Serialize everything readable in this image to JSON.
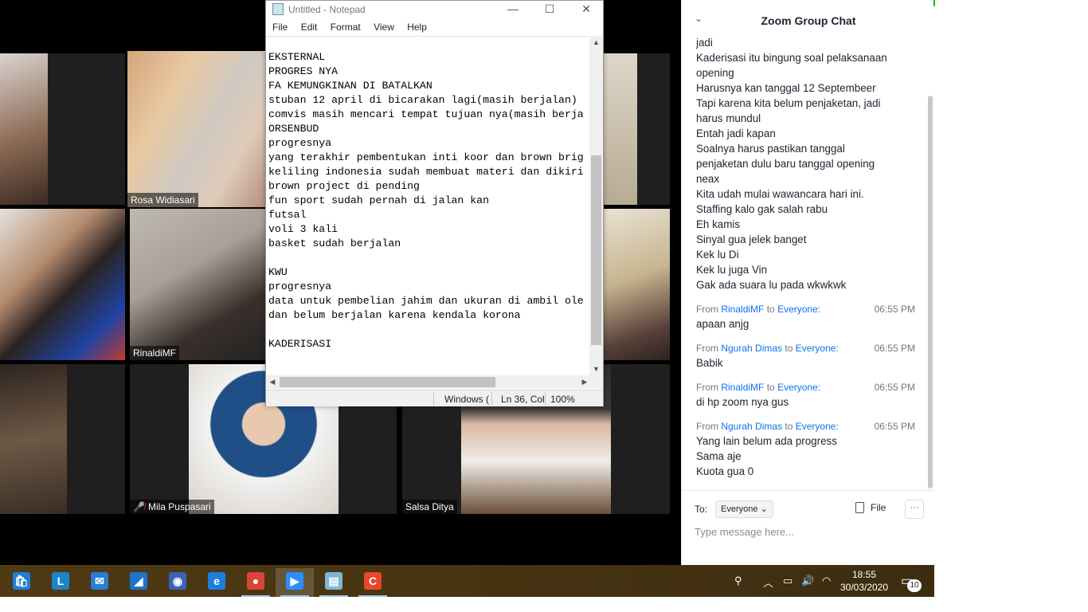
{
  "gallery": {
    "participants": [
      {
        "name": "Rosa Widiasari",
        "muted": false,
        "active": true
      },
      {
        "name": "RinaldiMF",
        "muted": false,
        "active": false
      },
      {
        "name": "Mila Puspasari",
        "muted": true,
        "active": false
      },
      {
        "name": "Salsa Ditya",
        "muted": false,
        "active": false
      }
    ]
  },
  "notepad": {
    "title": "Untitled - Notepad",
    "menu": [
      "File",
      "Edit",
      "Format",
      "View",
      "Help"
    ],
    "controls": {
      "minimize": "—",
      "maximize": "☐",
      "close": "✕"
    },
    "content": "EKSTERNAL\nPROGRES NYA\nFA KEMUNGKINAN DI BATALKAN\nstuban 12 april di bicarakan lagi(masih berjalan)\ncomvis masih mencari tempat tujuan nya(masih berja\nORSENBUD\nprogresnya\nyang terakhir pembentukan inti koor dan brown brig\nkeliling indonesia sudah membuat materi dan dikiri\nbrown project di pending\nfun sport sudah pernah di jalan kan\nfutsal\nvoli 3 kali\nbasket sudah berjalan\n\nKWU\nprogresnya\ndata untuk pembelian jahim dan ukuran di ambil ole\ndan belum berjalan karena kendala korona\n\nKADERISASI",
    "status": {
      "encoding": "Windows (",
      "position": "Ln 36, Col",
      "zoom": "100%"
    }
  },
  "chat": {
    "title": "Zoom Group Chat",
    "previous_lines": [
      "jadi",
      "Kaderisasi itu bingung soal pelaksanaan",
      "opening",
      "Harusnya kan tanggal 12 Septembeer",
      "Tapi karena kita belum penjaketan, jadi",
      "harus mundul",
      "Entah jadi kapan",
      "Soalnya harus pastikan tanggal",
      "penjaketan dulu baru tanggal opening",
      "neax",
      "Kita udah mulai wawancara hari ini.",
      "Staffing kalo gak salah rabu",
      "Eh kamis",
      "Sinyal gua jelek banget",
      "Kek lu Di",
      "Kek lu juga Vin",
      "Gak ada suara lu pada wkwkwk"
    ],
    "messages": [
      {
        "prefix": "From",
        "sender": "RinaldiMF",
        "to_word": "to",
        "recipient": "Everyone:",
        "time": "06:55 PM",
        "lines": [
          "apaan anjg"
        ]
      },
      {
        "prefix": "From",
        "sender": "Ngurah Dimas",
        "to_word": "to",
        "recipient": "Everyone:",
        "time": "06:55 PM",
        "lines": [
          "Babik"
        ]
      },
      {
        "prefix": "From",
        "sender": "RinaldiMF",
        "to_word": "to",
        "recipient": "Everyone:",
        "time": "06:55 PM",
        "lines": [
          "di hp zoom nya gus"
        ]
      },
      {
        "prefix": "From",
        "sender": "Ngurah Dimas",
        "to_word": "to",
        "recipient": "Everyone:",
        "time": "06:55 PM",
        "lines": [
          "Yang lain belum ada progress",
          "Sama aje",
          "Kuota gua 0"
        ]
      }
    ],
    "to_label": "To:",
    "recipient_select": "Everyone",
    "file_label": "File",
    "more_label": "···",
    "input_placeholder": "Type message here..."
  },
  "taskbar": {
    "apps": [
      {
        "icon": "store-icon",
        "glyph": "🛍",
        "color": "#1e7fd8"
      },
      {
        "icon": "l-app-icon",
        "glyph": "L",
        "color": "#1a86c9"
      },
      {
        "icon": "mail-icon",
        "glyph": "✉",
        "color": "#2b7cd3"
      },
      {
        "icon": "shark-icon",
        "glyph": "◢",
        "color": "#1d74c9"
      },
      {
        "icon": "firefox-icon",
        "glyph": "◉",
        "color": "#3a62b5"
      },
      {
        "icon": "edge-icon",
        "glyph": "e",
        "color": "#1b7fe0"
      },
      {
        "icon": "chrome-icon",
        "glyph": "●",
        "color": "#db4437"
      },
      {
        "icon": "zoom-icon",
        "glyph": "▶",
        "color": "#2d8cff"
      },
      {
        "icon": "notepad-icon",
        "glyph": "▤",
        "color": "#7fb6d6"
      },
      {
        "icon": "camtasia-icon",
        "glyph": "C",
        "color": "#e8472b"
      }
    ],
    "tray": {
      "clock_time": "18:55",
      "clock_date": "30/03/2020",
      "notifications": "10"
    }
  }
}
